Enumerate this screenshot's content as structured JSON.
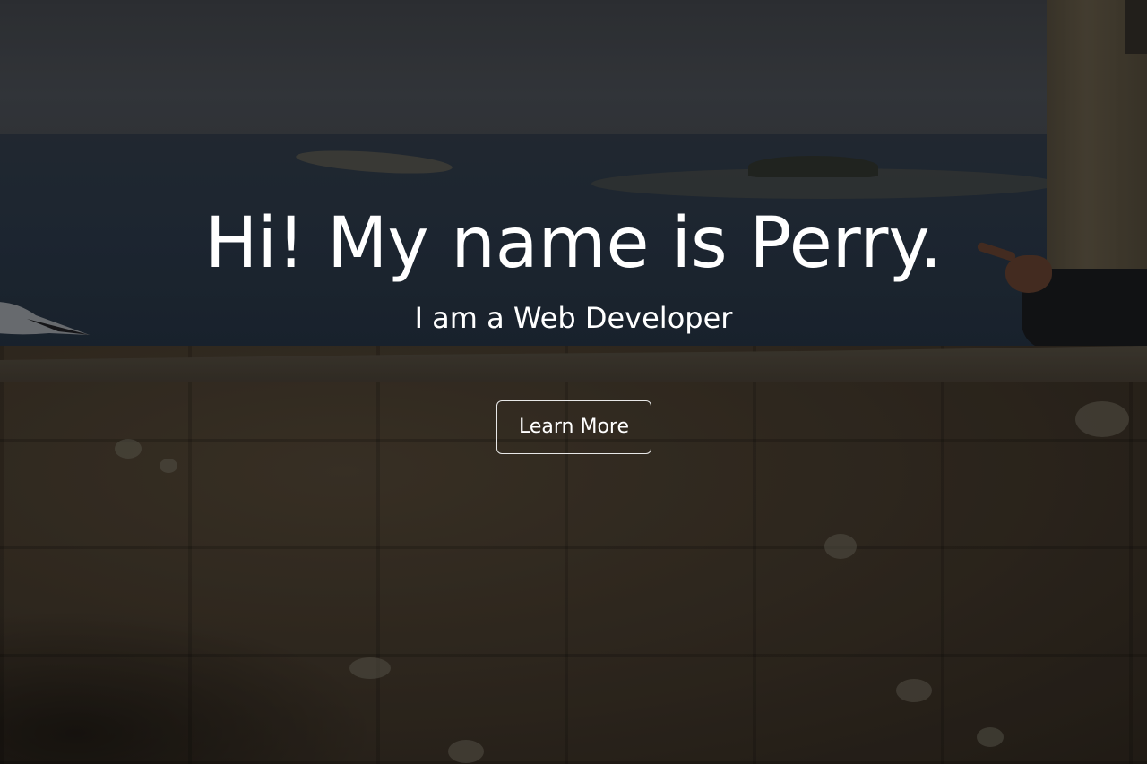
{
  "hero": {
    "headline": "Hi! My name is Perry.",
    "subheadline": "I am a Web Developer",
    "cta_label": "Learn More"
  },
  "colors": {
    "text": "#ffffff",
    "button_border": "#e8e8e8",
    "overlay": "rgba(0,0,0,0.25)"
  }
}
